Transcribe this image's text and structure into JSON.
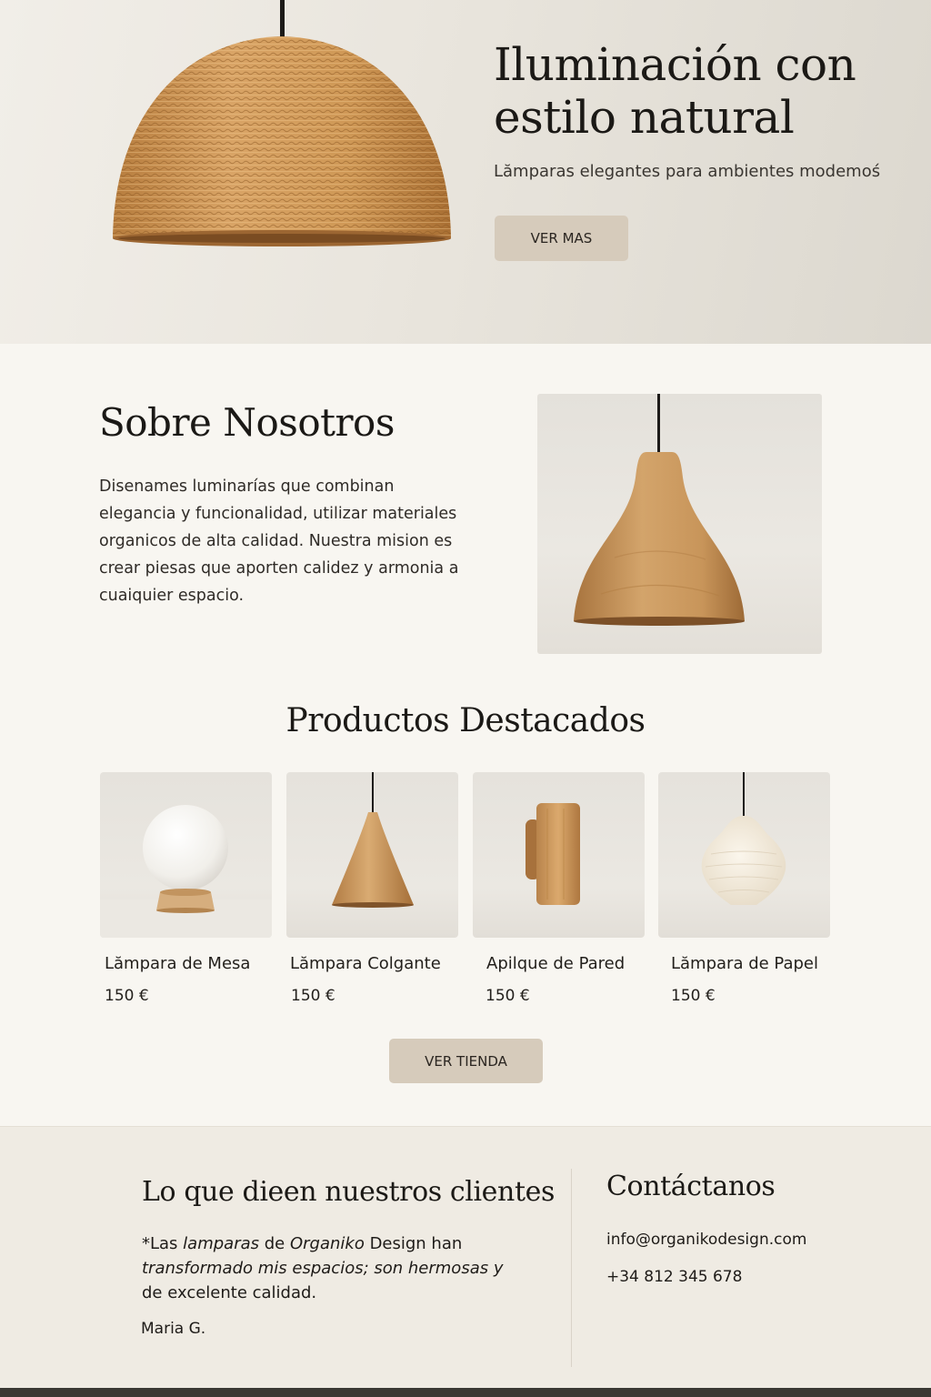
{
  "hero": {
    "title": "Iluminación con estilo natural",
    "subtitle": "Lămparas elegantes para ambientes modemoś",
    "button_label": "VER MAS",
    "lamp_image": "wicker-pendant-lamp"
  },
  "about": {
    "title": "Sobre Nosotros",
    "text": "Disenames luminarías que combinan elegancia y funcionalidad, utilizar materiales organicos de alta calidad. Nuestra mision es crear piesas que aporten calidez y armonia a cuaiquier espacio.",
    "image": "wooden-pendant-lamp"
  },
  "products": {
    "title": "Productos Destacados",
    "items": [
      {
        "name": "Lămpara de Mesa",
        "price": "150 €",
        "image": "globe-table-lamp"
      },
      {
        "name": "Lămpara Colgante",
        "price": "150 €",
        "image": "wooden-cone-pendant"
      },
      {
        "name": "Apilque de Pared",
        "price": "150 €",
        "image": "wooden-wall-sconce"
      },
      {
        "name": "Lămpara de Papel",
        "price": "150 €",
        "image": "paper-pendant-lamp"
      }
    ],
    "button_label": "VER TIENDA"
  },
  "testimonials": {
    "title": "Lo que dieen nuestros clientes",
    "quote_parts": [
      "*Las ",
      "lamparas",
      " de ",
      "Organiko",
      " Design han ",
      "transformado mis espacios; son hermosas y",
      " de excelente calidad."
    ],
    "author": "Maria G."
  },
  "contact": {
    "title": "Contáctanos",
    "email": "info@organikodesign.com",
    "phone": "+34 812 345 678"
  },
  "colors": {
    "background": "#f8f6f1",
    "button": "#d6cbbb",
    "section_alt": "#efebe3",
    "wood": "#c99a62"
  }
}
